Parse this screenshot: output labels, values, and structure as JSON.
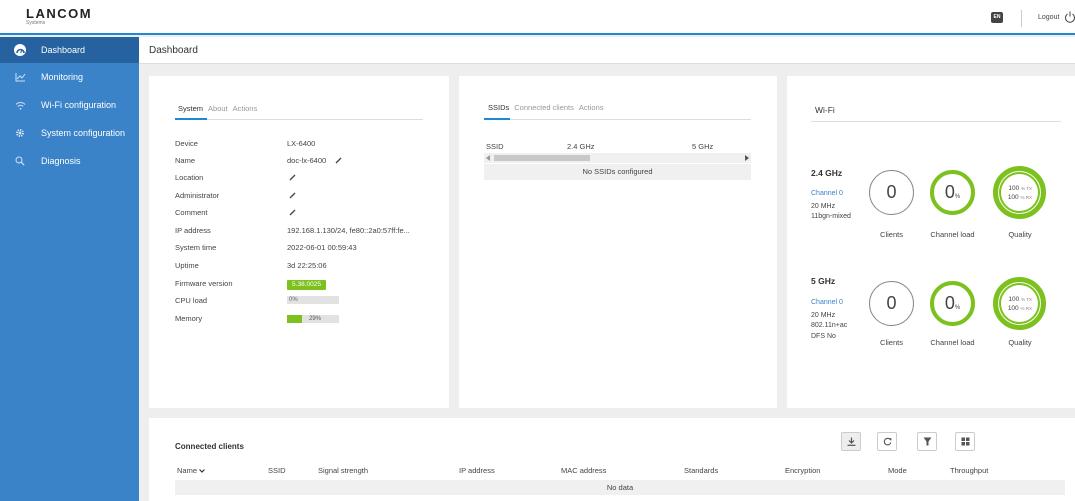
{
  "header": {
    "logo": "LANCOM",
    "logo_sub": "Systems",
    "language": "EN",
    "logout": "Logout"
  },
  "sidebar": {
    "items": [
      {
        "label": "Dashboard",
        "icon": "dashboard-icon",
        "active": true
      },
      {
        "label": "Monitoring",
        "icon": "chart-icon"
      },
      {
        "label": "Wi-Fi configuration",
        "icon": "wifi-icon"
      },
      {
        "label": "System configuration",
        "icon": "gear-icon"
      },
      {
        "label": "Diagnosis",
        "icon": "search-icon"
      }
    ]
  },
  "page": {
    "title": "Dashboard"
  },
  "system_panel": {
    "tabs": [
      "System",
      "About",
      "Actions"
    ],
    "active_tab": "System",
    "rows": [
      {
        "label": "Device",
        "value": "LX-6400"
      },
      {
        "label": "Name",
        "value": "doc-lx-6400"
      },
      {
        "label": "Location",
        "value": ""
      },
      {
        "label": "Administrator",
        "value": ""
      },
      {
        "label": "Comment",
        "value": ""
      },
      {
        "label": "IP address",
        "value": "192.168.1.130/24, fe80::2a0:57ff:fe..."
      },
      {
        "label": "System time",
        "value": "2022-06-01 00:59:43"
      },
      {
        "label": "Uptime",
        "value": "3d 22:25:06"
      },
      {
        "label": "Firmware version",
        "value": "5.38.0025"
      },
      {
        "label": "CPU load",
        "value": "0%"
      },
      {
        "label": "Memory",
        "value": "29%"
      }
    ],
    "cpu_load": 0,
    "memory": 29
  },
  "ssid_panel": {
    "tabs": [
      "SSIDs",
      "Connected clients",
      "Actions"
    ],
    "active_tab": "SSIDs",
    "columns": [
      "SSID",
      "2.4 GHz",
      "5 GHz"
    ],
    "empty_text": "No SSIDs configured"
  },
  "wifi_panel": {
    "title": "Wi-Fi",
    "bands": [
      {
        "name": "2.4 GHz",
        "channel": "Channel 0",
        "width": "20 MHz",
        "mode": "11bgn-mixed",
        "extra": "",
        "clients": "0",
        "channel_load": "0",
        "quality_tx": "100",
        "quality_rx": "100"
      },
      {
        "name": "5 GHz",
        "channel": "Channel 0",
        "width": "20 MHz",
        "mode": "802.11n+ac",
        "extra": "DFS No",
        "clients": "0",
        "channel_load": "0",
        "quality_tx": "100",
        "quality_rx": "100"
      }
    ],
    "labels": {
      "clients": "Clients",
      "channel_load": "Channel load",
      "quality": "Quality",
      "pct": "%",
      "tx": "% TX",
      "rx": "% RX"
    }
  },
  "clients_panel": {
    "title": "Connected clients",
    "columns": [
      "Name",
      "SSID",
      "Signal strength",
      "IP address",
      "MAC address",
      "Standards",
      "Encryption",
      "Mode",
      "Throughput"
    ],
    "empty_text": "No data"
  },
  "colors": {
    "accent": "#1e88d6",
    "sidebar": "#3a83c9",
    "sidebar_active": "#25629f",
    "green": "#7cc11d"
  }
}
